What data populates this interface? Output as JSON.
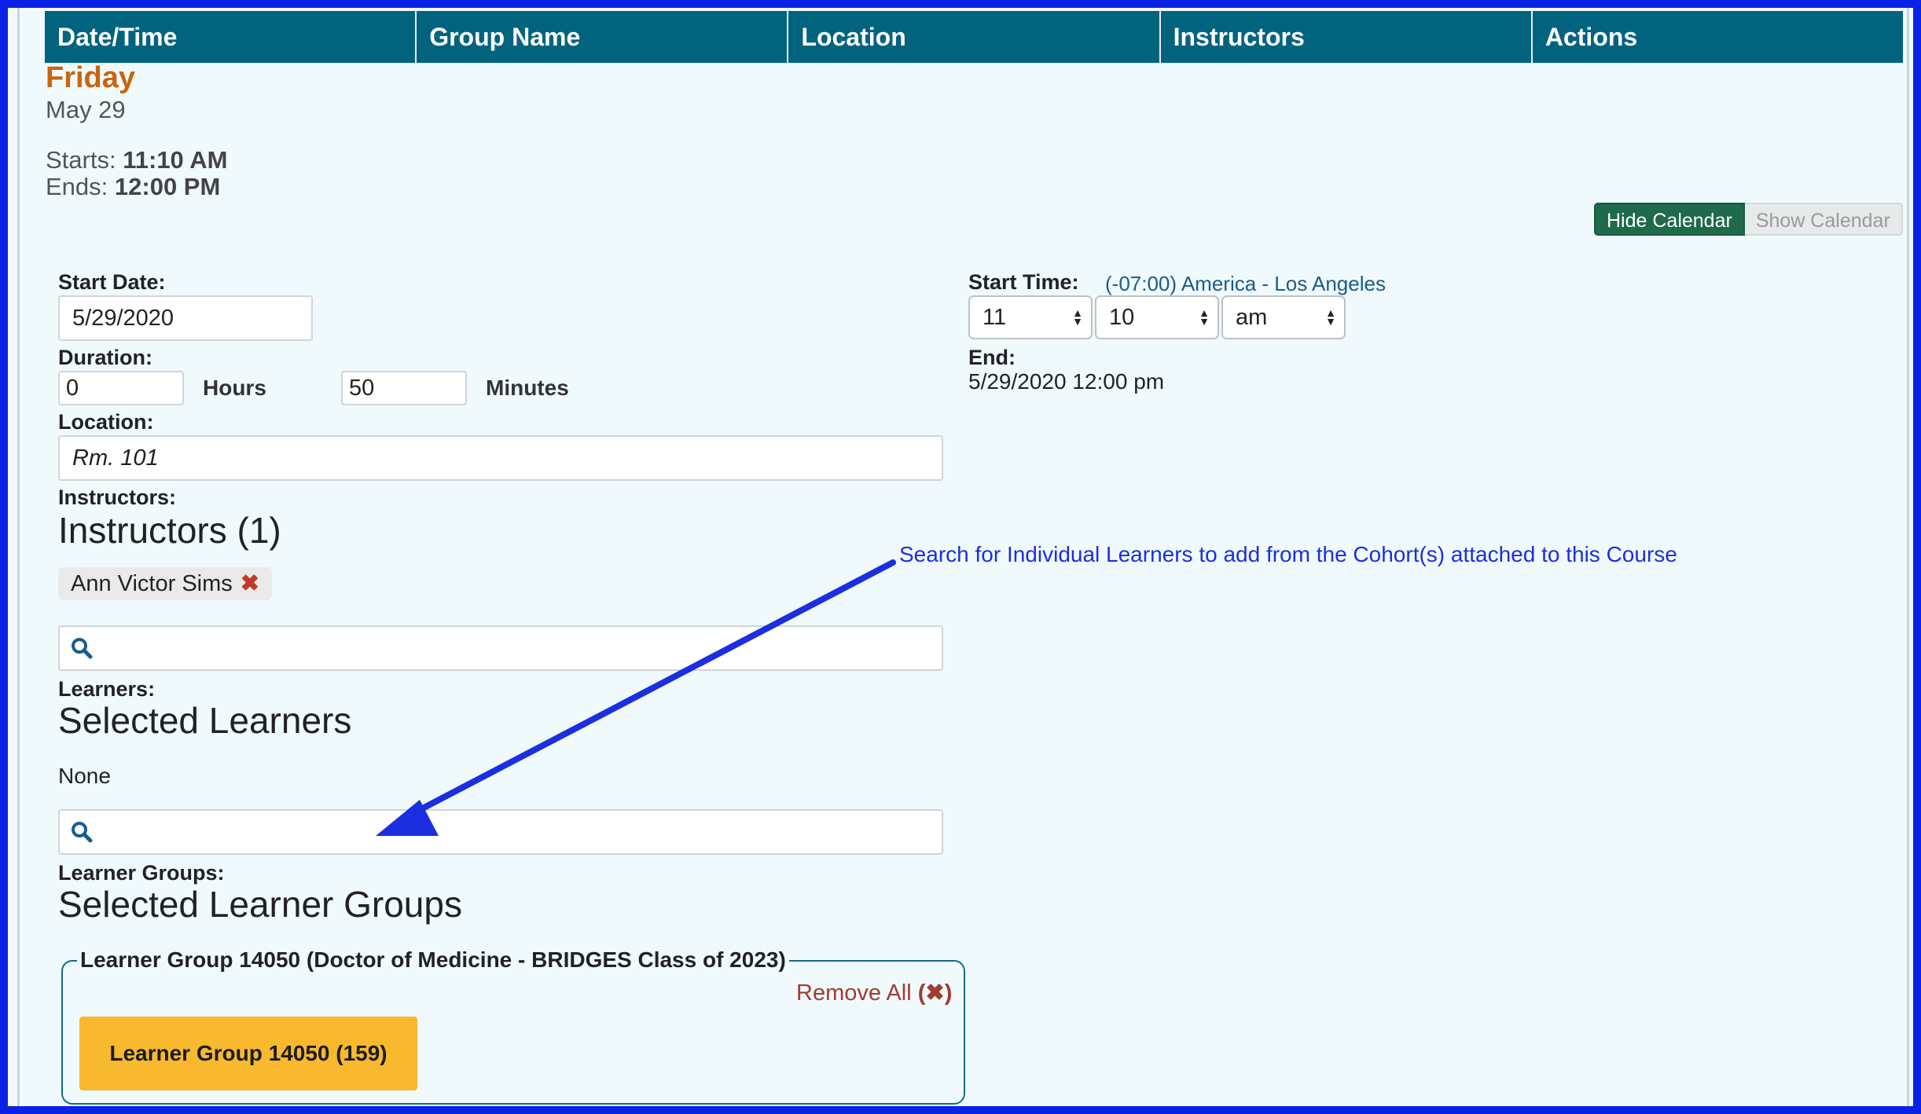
{
  "table_header": [
    "Date/Time",
    "Group Name",
    "Location",
    "Instructors",
    "Actions"
  ],
  "session": {
    "day": "Friday",
    "date": "May 29",
    "starts_label": "Starts:",
    "starts_value": "11:10 AM",
    "ends_label": "Ends:",
    "ends_value": "12:00 PM"
  },
  "calendar": {
    "hide_label": "Hide Calendar",
    "show_label": "Show Calendar"
  },
  "form": {
    "start_date_label": "Start Date:",
    "start_date_value": "5/29/2020",
    "duration_label": "Duration:",
    "hours_value": "0",
    "hours_label": "Hours",
    "minutes_value": "50",
    "minutes_label": "Minutes",
    "location_label": "Location:",
    "location_value": "Rm. 101",
    "start_time_label": "Start Time:",
    "timezone": "(-07:00) America - Los Angeles",
    "hour_value": "11",
    "minute_value": "10",
    "ampm_value": "am",
    "end_label": "End:",
    "end_value": "5/29/2020 12:00 pm"
  },
  "instructors": {
    "label": "Instructors:",
    "heading": "Instructors (1)",
    "chips": [
      "Ann Victor Sims"
    ],
    "remove_glyph": "✖"
  },
  "learners": {
    "label": "Learners:",
    "heading": "Selected Learners",
    "none_text": "None"
  },
  "learner_groups": {
    "label": "Learner Groups:",
    "heading": "Selected Learner Groups",
    "legend": "Learner Group 14050 (Doctor of Medicine - BRIDGES Class of 2023)",
    "remove_all": "Remove All",
    "group_button": "Learner Group 14050 (159)"
  },
  "callout": "Search for Individual Learners to add from the Cohort(s) attached to this Course",
  "colors": {
    "frame": "#0a22e6",
    "header": "#02637f",
    "day": "#c8650f",
    "hide_calendar": "#1f6a4b",
    "group_button": "#f8b92e",
    "arrow": "#1b2ee0"
  },
  "icons": [
    "search-icon",
    "remove-icon",
    "arrow-icon",
    "select-caret-icon"
  ]
}
